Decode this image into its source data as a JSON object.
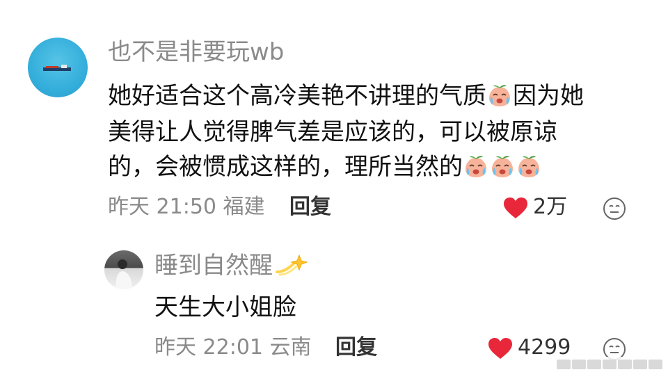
{
  "main_comment": {
    "username": "也不是非要玩wb",
    "lines": [
      "她好适合这个高冷美艳不讲理的气质",
      "因为她",
      "美得让人觉得脾气差是应该的，可以被原谅",
      "的，会被惯成这样的，理所当然的"
    ],
    "time": "昨天 21:50",
    "location": "福建",
    "reply_label": "回复",
    "like_count": "2万"
  },
  "reply_comment": {
    "username": "睡到自然醒",
    "text": "天生大小姐脸",
    "time": "昨天 22:01",
    "location": "云南",
    "reply_label": "回复",
    "like_count": "4299"
  },
  "icons": {
    "like": "heart-icon",
    "react": "smiley-face-icon",
    "emoji": "crying-peach-emoji",
    "badge": "sparkle-star-emoji"
  },
  "colors": {
    "like_red": "#e8273b",
    "muted_text": "#8a8a8a",
    "avatar_blue": "#34aedb"
  }
}
